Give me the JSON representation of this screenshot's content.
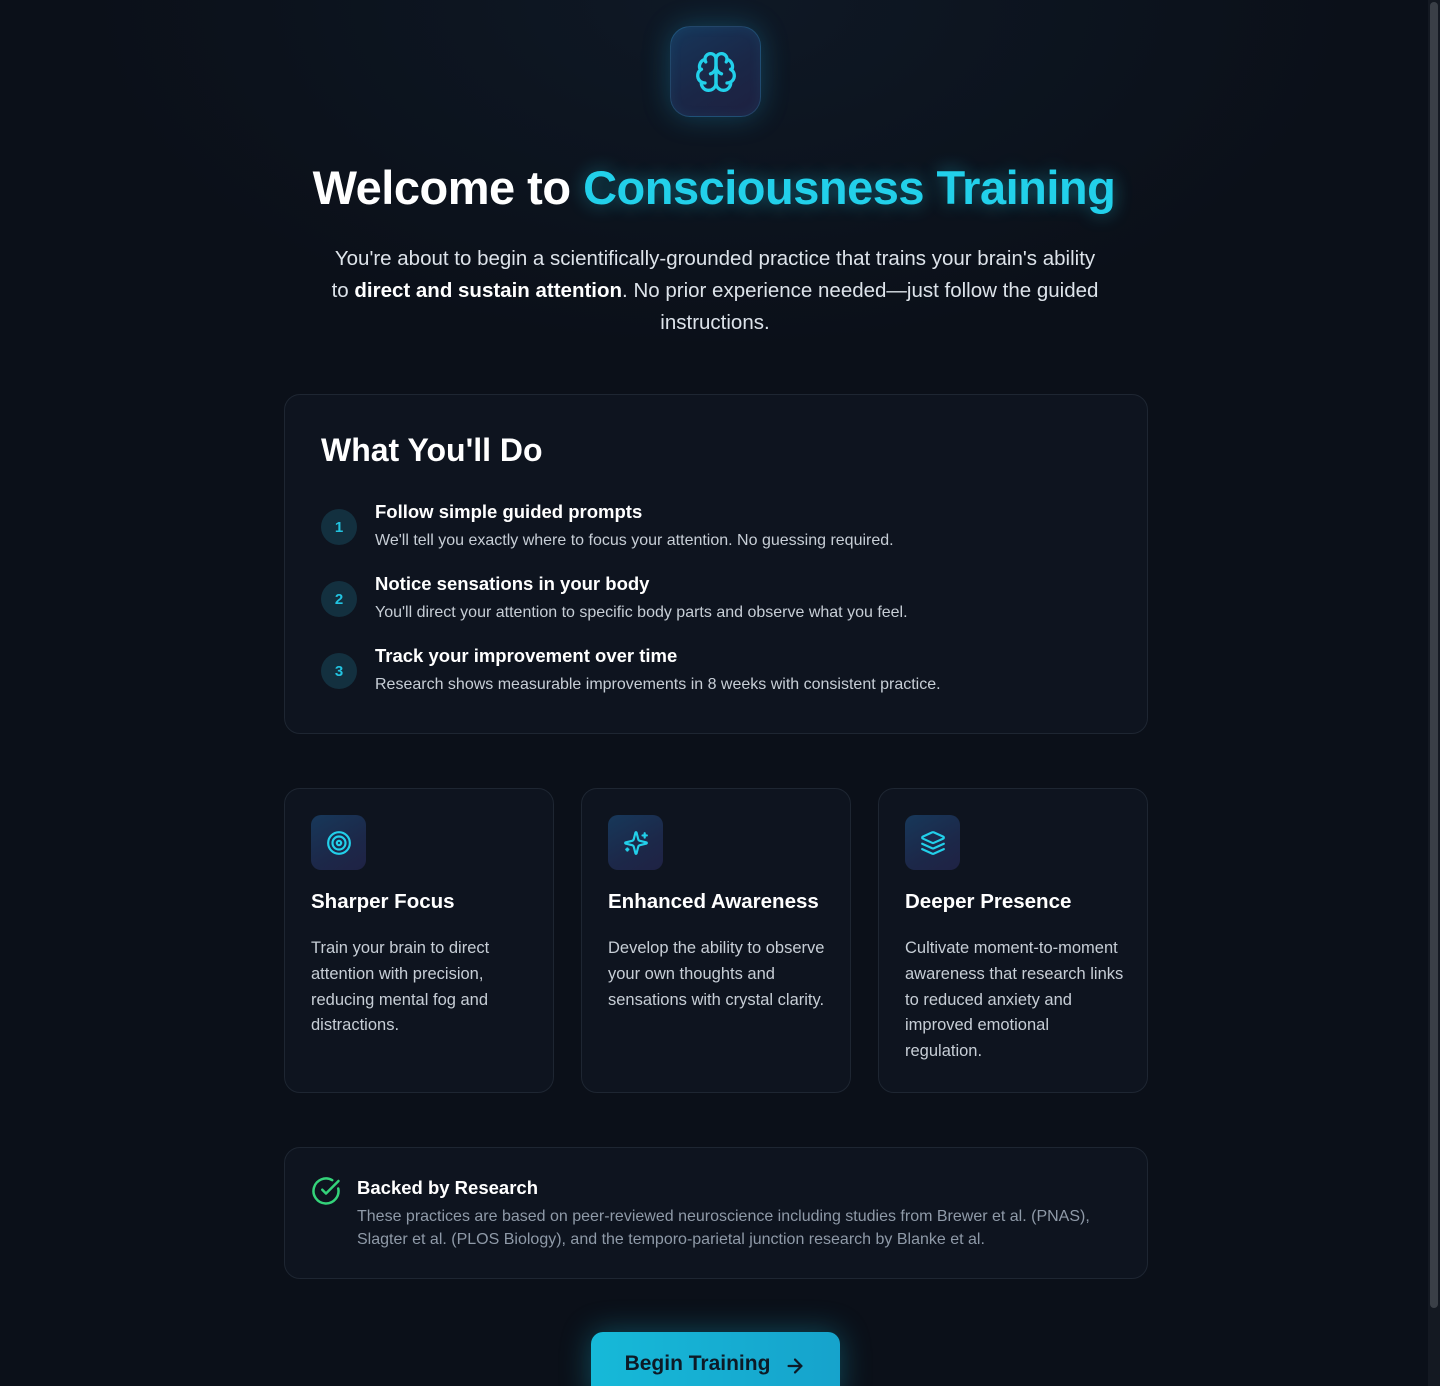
{
  "hero": {
    "icon": "brain-icon",
    "title_prefix": "Welcome to ",
    "title_accent": "Consciousness Training",
    "subtitle_part1": "You're about to begin a scientifically-grounded practice that trains your brain's ability to ",
    "subtitle_bold": "direct and sustain attention",
    "subtitle_part2": ". No prior experience needed—just follow the guided instructions."
  },
  "steps": {
    "title": "What You'll Do",
    "items": [
      {
        "number": "1",
        "title": "Follow simple guided prompts",
        "description": "We'll tell you exactly where to focus your attention. No guessing required."
      },
      {
        "number": "2",
        "title": "Notice sensations in your body",
        "description": "You'll direct your attention to specific body parts and observe what you feel."
      },
      {
        "number": "3",
        "title": "Track your improvement over time",
        "description": "Research shows measurable improvements in 8 weeks with consistent practice."
      }
    ]
  },
  "features": [
    {
      "icon": "target-icon",
      "title": "Sharper Focus",
      "description": "Train your brain to direct attention with precision, reducing mental fog and distractions."
    },
    {
      "icon": "sparkles-icon",
      "title": "Enhanced Awareness",
      "description": "Develop the ability to observe your own thoughts and sensations with crystal clarity."
    },
    {
      "icon": "layers-icon",
      "title": "Deeper Presence",
      "description": "Cultivate moment-to-moment awareness that research links to reduced anxiety and improved emotional regulation."
    }
  ],
  "research": {
    "icon": "check-circle-icon",
    "title": "Backed by Research",
    "description": "These practices are based on peer-reviewed neuroscience including studies from Brewer et al. (PNAS), Slagter et al. (PLOS Biology), and the temporo-parietal junction research by Blanke et al."
  },
  "cta": {
    "label": "Begin Training",
    "icon": "arrow-right-icon"
  },
  "colors": {
    "background": "#0b1019",
    "accent": "#22d0ea",
    "success": "#34d37a",
    "card_border": "#1e2632"
  }
}
